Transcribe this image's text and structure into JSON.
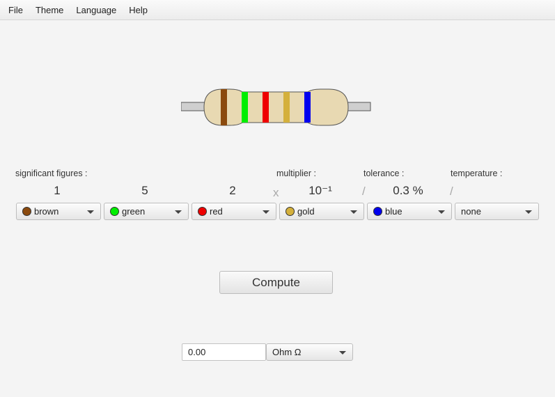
{
  "menu": {
    "file": "File",
    "theme": "Theme",
    "language": "Language",
    "help": "Help"
  },
  "resistor": {
    "body_color": "#e8d9b2",
    "bands": [
      {
        "name": "brown",
        "color": "#8b4a0e"
      },
      {
        "name": "green",
        "color": "#00ee00"
      },
      {
        "name": "red",
        "color": "#ee0000"
      },
      {
        "name": "gold",
        "color": "#d4b03c"
      },
      {
        "name": "blue",
        "color": "#0000ee"
      }
    ]
  },
  "labels": {
    "significant_figures": "significant figures :",
    "multiplier": "multiplier :",
    "tolerance": "tolerance :",
    "temperature": "temperature :"
  },
  "values": {
    "digit1": "1",
    "digit2": "5",
    "digit3": "2",
    "times": "x",
    "multiplier": "10⁻¹",
    "slash1": "/",
    "tolerance": "0.3 %",
    "slash2": "/"
  },
  "selects": [
    {
      "label": "brown",
      "color": "#8b4a0e"
    },
    {
      "label": "green",
      "color": "#00ee00"
    },
    {
      "label": "red",
      "color": "#ee0000"
    },
    {
      "label": "gold",
      "color": "#d4b03c"
    },
    {
      "label": "blue",
      "color": "#0000ee"
    },
    {
      "label": "none",
      "color": ""
    }
  ],
  "compute_label": "Compute",
  "result": {
    "value": "0.00",
    "unit": "Ohm Ω"
  }
}
